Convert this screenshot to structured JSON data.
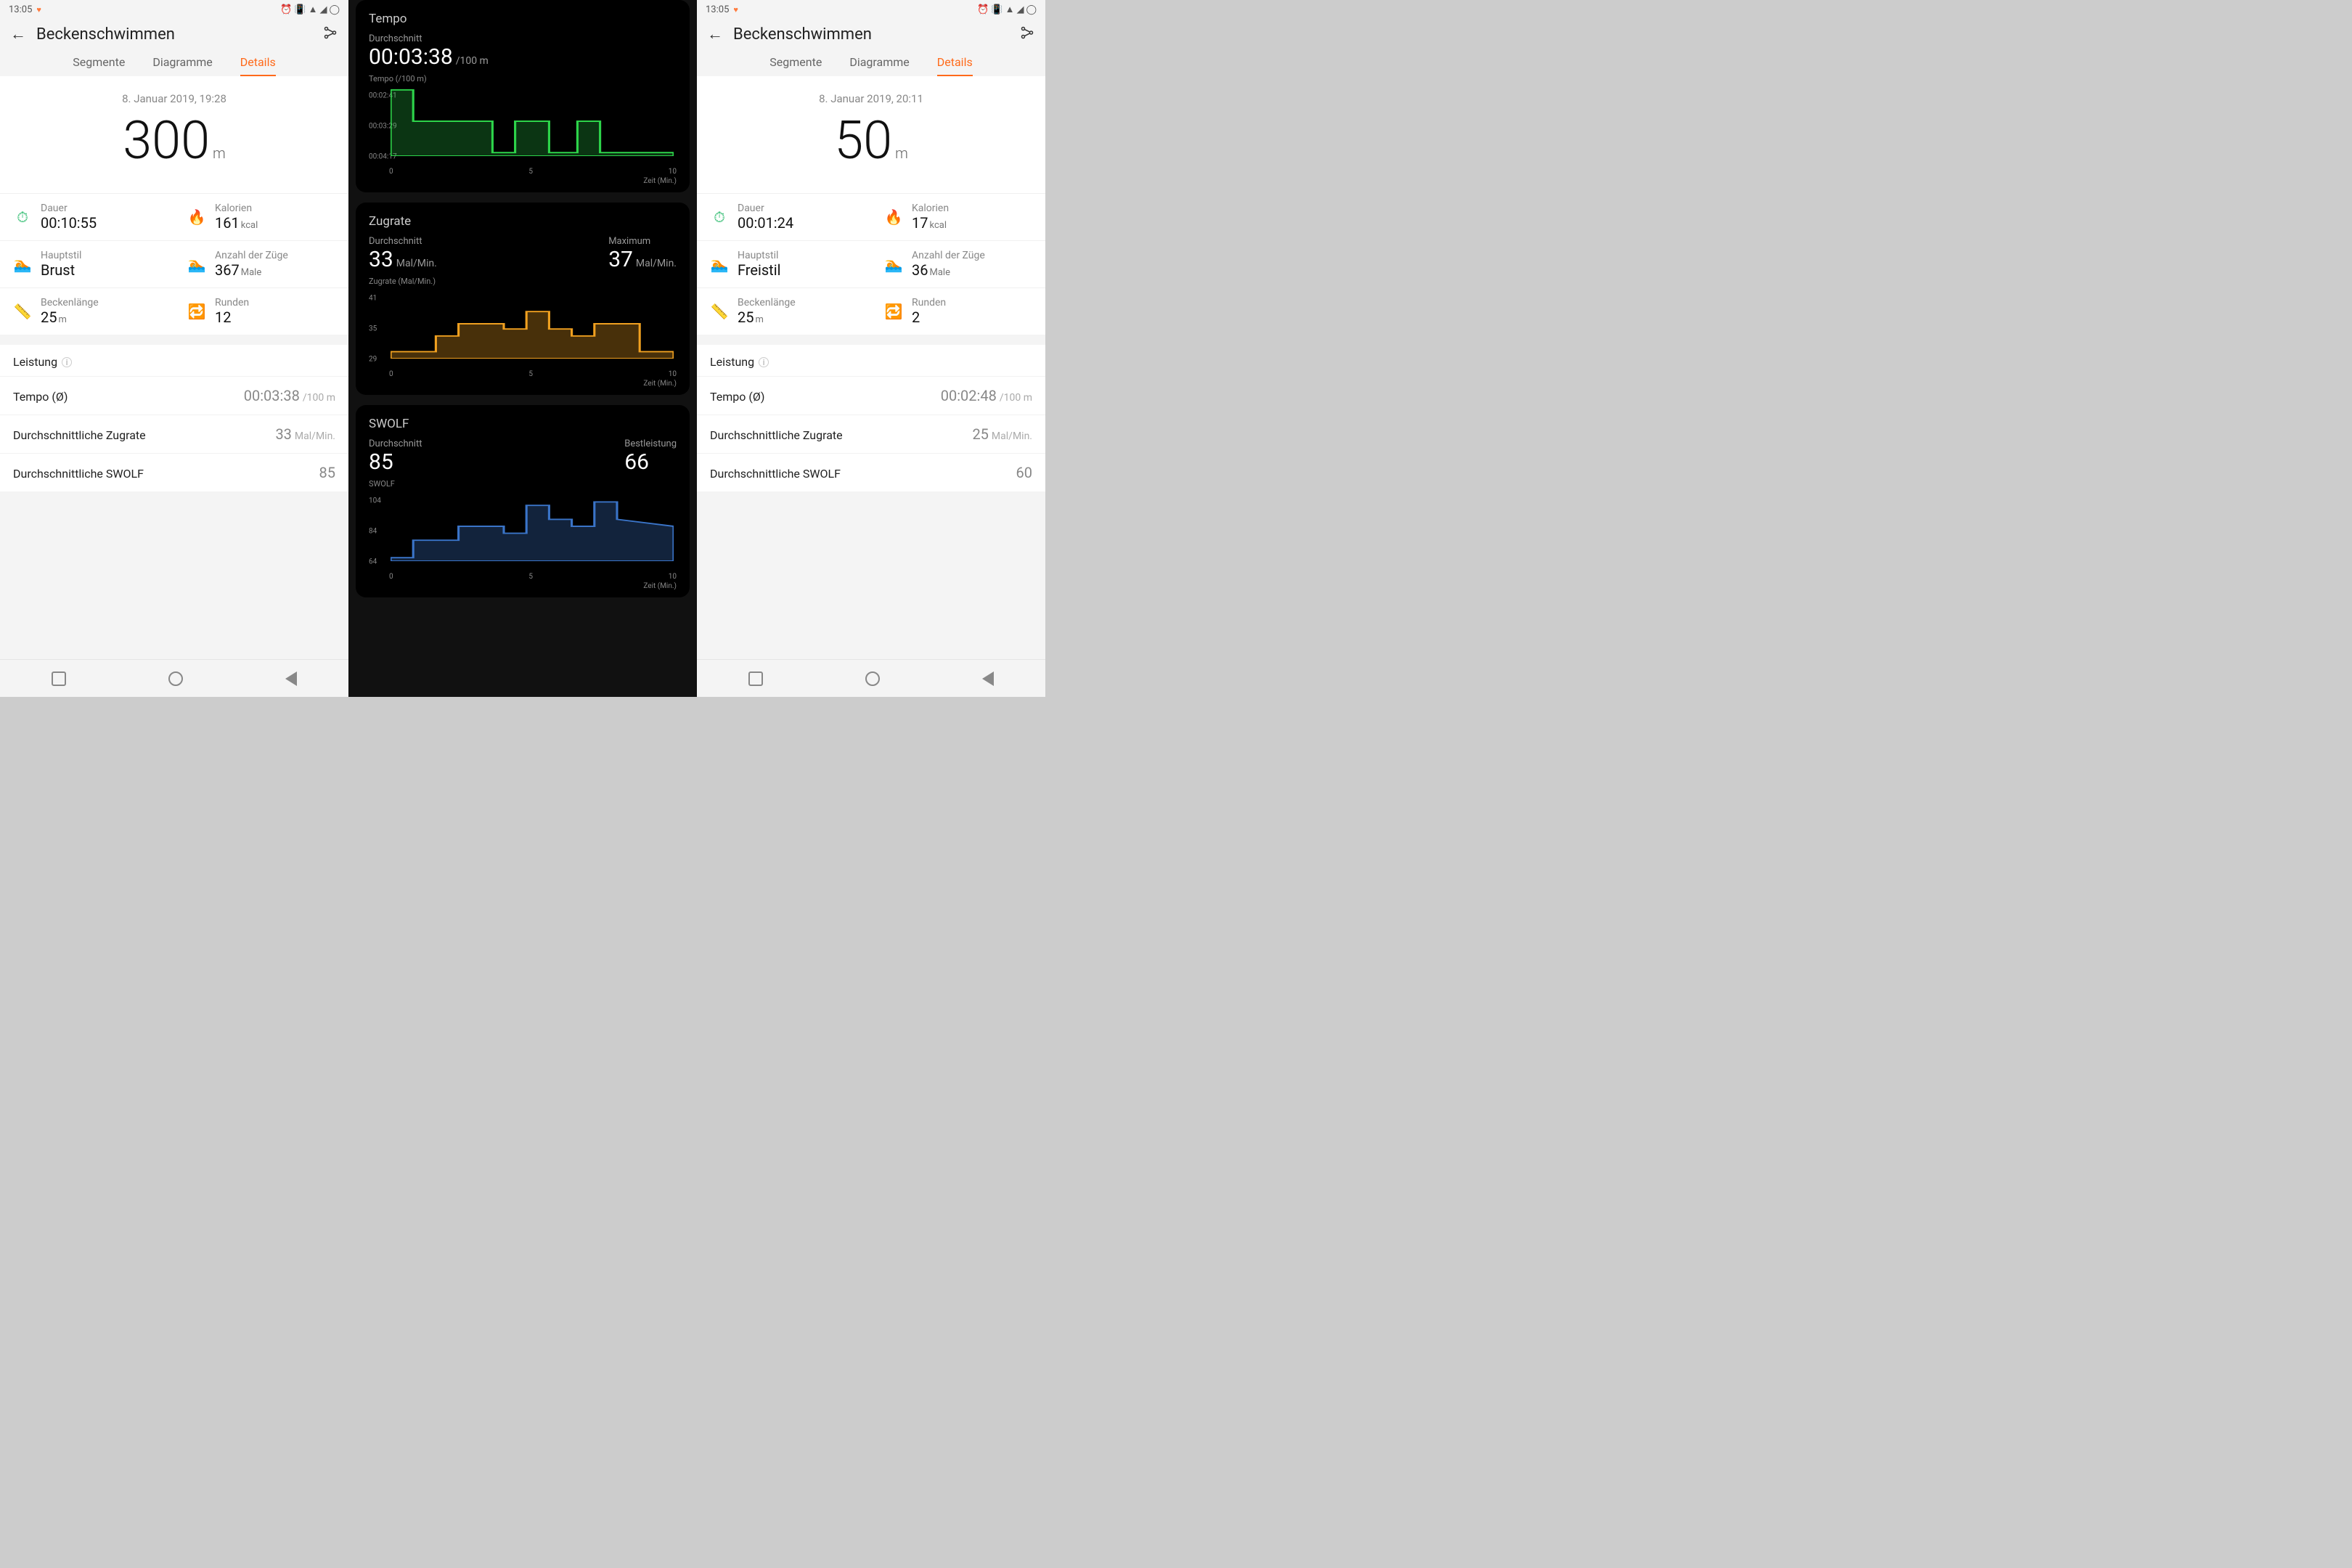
{
  "status": {
    "time": "13:05",
    "icons_right": [
      "alarm",
      "vibrate",
      "wifi",
      "signal",
      "loading"
    ]
  },
  "header": {
    "title": "Beckenschwimmen",
    "tabs": [
      "Segmente",
      "Diagramme",
      "Details"
    ],
    "active_tab": "Details"
  },
  "session_a": {
    "datetime": "8. Januar 2019, 19:28",
    "distance_value": "300",
    "distance_unit": "m",
    "stats": {
      "dauer": {
        "label": "Dauer",
        "value": "00:10:55",
        "unit": ""
      },
      "kalorien": {
        "label": "Kalorien",
        "value": "161",
        "unit": "kcal"
      },
      "hauptstil": {
        "label": "Hauptstil",
        "value": "Brust",
        "unit": ""
      },
      "zuege": {
        "label": "Anzahl der Züge",
        "value": "367",
        "unit": "Male"
      },
      "beckenlaenge": {
        "label": "Beckenlänge",
        "value": "25",
        "unit": "m"
      },
      "runden": {
        "label": "Runden",
        "value": "12",
        "unit": ""
      }
    },
    "perf_title": "Leistung",
    "perf": {
      "tempo": {
        "label": "Tempo (Ø)",
        "value": "00:03:38",
        "unit": "/100 m"
      },
      "zugrate": {
        "label": "Durchschnittliche Zugrate",
        "value": "33",
        "unit": "Mal/Min."
      },
      "swolf": {
        "label": "Durchschnittliche SWOLF",
        "value": "85",
        "unit": ""
      }
    }
  },
  "session_b": {
    "datetime": "8. Januar 2019, 20:11",
    "distance_value": "50",
    "distance_unit": "m",
    "stats": {
      "dauer": {
        "label": "Dauer",
        "value": "00:01:24",
        "unit": ""
      },
      "kalorien": {
        "label": "Kalorien",
        "value": "17",
        "unit": "kcal"
      },
      "hauptstil": {
        "label": "Hauptstil",
        "value": "Freistil",
        "unit": ""
      },
      "zuege": {
        "label": "Anzahl der Züge",
        "value": "36",
        "unit": "Male"
      },
      "beckenlaenge": {
        "label": "Beckenlänge",
        "value": "25",
        "unit": "m"
      },
      "runden": {
        "label": "Runden",
        "value": "2",
        "unit": ""
      }
    },
    "perf_title": "Leistung",
    "perf": {
      "tempo": {
        "label": "Tempo (Ø)",
        "value": "00:02:48",
        "unit": "/100 m"
      },
      "zugrate": {
        "label": "Durchschnittliche Zugrate",
        "value": "25",
        "unit": "Mal/Min."
      },
      "swolf": {
        "label": "Durchschnittliche SWOLF",
        "value": "60",
        "unit": ""
      }
    }
  },
  "dark": {
    "tempo": {
      "title": "Tempo",
      "avg_label": "Durchschnitt",
      "avg_value": "00:03:38",
      "avg_unit": "/100 m",
      "chart_label": "Tempo (/100 m)"
    },
    "zugrate": {
      "title": "Zugrate",
      "avg_label": "Durchschnitt",
      "avg_value": "33",
      "avg_unit": "Mal/Min.",
      "max_label": "Maximum",
      "max_value": "37",
      "max_unit": "Mal/Min.",
      "chart_label": "Zugrate (Mal/Min.)"
    },
    "swolf": {
      "title": "SWOLF",
      "avg_label": "Durchschnitt",
      "avg_value": "85",
      "best_label": "Bestleistung",
      "best_value": "66",
      "chart_label": "SWOLF"
    },
    "xaxis": {
      "t0": "0",
      "t1": "5",
      "t2": "10",
      "unit": "Zeit (Min.)"
    }
  },
  "chart_data": [
    {
      "type": "line",
      "title": "Tempo (/100 m)",
      "xlabel": "Zeit (Min.)",
      "x": [
        0,
        1,
        2,
        3,
        4,
        5,
        6,
        7,
        8,
        9,
        10,
        11
      ],
      "y_ticks": [
        "00:02:41",
        "00:03:29",
        "00:04:17"
      ],
      "y_numeric_ticks": [
        161,
        209,
        257
      ],
      "values": [
        161,
        209,
        209,
        209,
        257,
        209,
        209,
        257,
        209,
        257,
        257,
        257
      ],
      "ylim": [
        161,
        257
      ],
      "color": "#2dd44a",
      "note": "y is seconds per 100m; higher = slower; plotted inverted (faster on top)"
    },
    {
      "type": "line",
      "title": "Zugrate (Mal/Min.)",
      "xlabel": "Zeit (Min.)",
      "x": [
        0,
        1,
        2,
        3,
        4,
        5,
        6,
        7,
        8,
        9,
        10,
        11
      ],
      "y_ticks": [
        "29",
        "35",
        "41"
      ],
      "values": [
        30,
        30,
        33,
        35,
        35,
        34,
        37,
        34,
        33,
        35,
        35,
        30
      ],
      "ylim": [
        29,
        41
      ],
      "color": "#f0a020"
    },
    {
      "type": "line",
      "title": "SWOLF",
      "xlabel": "Zeit (Min.)",
      "x": [
        0,
        1,
        2,
        3,
        4,
        5,
        6,
        7,
        8,
        9,
        10,
        11
      ],
      "y_ticks": [
        "64",
        "84",
        "104"
      ],
      "values": [
        66,
        76,
        76,
        84,
        84,
        80,
        96,
        88,
        84,
        98,
        88,
        84
      ],
      "ylim": [
        64,
        104
      ],
      "color": "#3a74c8"
    }
  ]
}
